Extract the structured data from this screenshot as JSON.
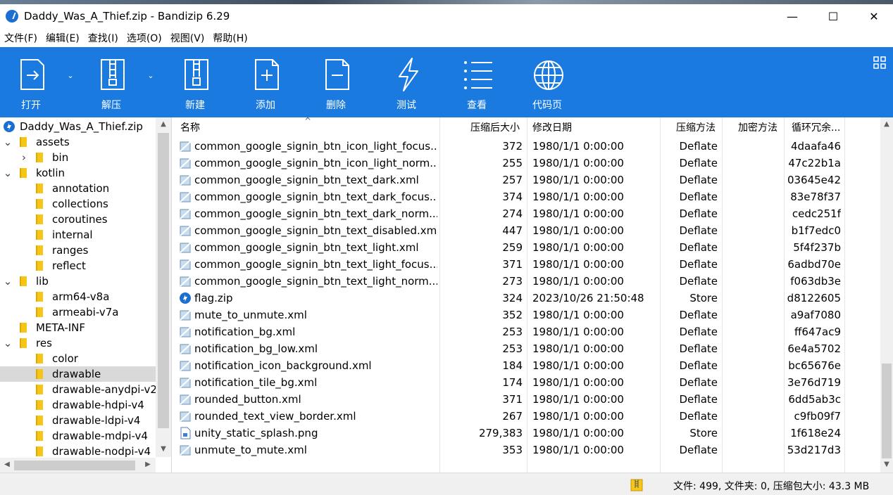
{
  "window": {
    "title": "Daddy_Was_A_Thief.zip - Bandizip 6.29",
    "minimize": "—",
    "maximize": "☐",
    "close": "✕"
  },
  "menu": [
    "文件(F)",
    "编辑(E)",
    "查找(I)",
    "选项(O)",
    "视图(V)",
    "帮助(H)"
  ],
  "toolbar": {
    "open": "打开",
    "extract": "解压",
    "new": "新建",
    "add": "添加",
    "delete": "删除",
    "test": "测试",
    "view": "查看",
    "codepage": "代码页"
  },
  "tree": {
    "root": "Daddy_Was_A_Thief.zip",
    "items": [
      {
        "label": "assets",
        "twist": "v"
      },
      {
        "label": "bin",
        "twist": ">"
      },
      {
        "label": "kotlin",
        "twist": "v"
      },
      {
        "label": "annotation",
        "twist": ""
      },
      {
        "label": "collections",
        "twist": ""
      },
      {
        "label": "coroutines",
        "twist": ""
      },
      {
        "label": "internal",
        "twist": ""
      },
      {
        "label": "ranges",
        "twist": ""
      },
      {
        "label": "reflect",
        "twist": ""
      },
      {
        "label": "lib",
        "twist": "v"
      },
      {
        "label": "arm64-v8a",
        "twist": ""
      },
      {
        "label": "armeabi-v7a",
        "twist": ""
      },
      {
        "label": "META-INF",
        "twist": ""
      },
      {
        "label": "res",
        "twist": "v"
      },
      {
        "label": "color",
        "twist": ""
      },
      {
        "label": "drawable",
        "twist": "",
        "selected": true
      },
      {
        "label": "drawable-anydpi-v2",
        "twist": ""
      },
      {
        "label": "drawable-hdpi-v4",
        "twist": ""
      },
      {
        "label": "drawable-ldpi-v4",
        "twist": ""
      },
      {
        "label": "drawable-mdpi-v4",
        "twist": ""
      },
      {
        "label": "drawable-nodpi-v4",
        "twist": ""
      }
    ]
  },
  "columns": {
    "name": "名称",
    "size": "压缩后大小",
    "date": "修改日期",
    "method": "压缩方法",
    "encryption": "加密方法",
    "crc": "循环冗余..."
  },
  "files": [
    {
      "name": "common_google_signin_btn_icon_light_focus...",
      "size": "372",
      "date": "1980/1/1 0:00:00",
      "method": "Deflate",
      "crc": "4daafa46",
      "type": "xml"
    },
    {
      "name": "common_google_signin_btn_icon_light_norm...",
      "size": "255",
      "date": "1980/1/1 0:00:00",
      "method": "Deflate",
      "crc": "47c22b1a",
      "type": "xml"
    },
    {
      "name": "common_google_signin_btn_text_dark.xml",
      "size": "257",
      "date": "1980/1/1 0:00:00",
      "method": "Deflate",
      "crc": "03645e42",
      "type": "xml"
    },
    {
      "name": "common_google_signin_btn_text_dark_focus...",
      "size": "374",
      "date": "1980/1/1 0:00:00",
      "method": "Deflate",
      "crc": "83e78f37",
      "type": "xml"
    },
    {
      "name": "common_google_signin_btn_text_dark_norm...",
      "size": "274",
      "date": "1980/1/1 0:00:00",
      "method": "Deflate",
      "crc": "cedc251f",
      "type": "xml"
    },
    {
      "name": "common_google_signin_btn_text_disabled.xml",
      "size": "447",
      "date": "1980/1/1 0:00:00",
      "method": "Deflate",
      "crc": "b1f7edc0",
      "type": "xml"
    },
    {
      "name": "common_google_signin_btn_text_light.xml",
      "size": "259",
      "date": "1980/1/1 0:00:00",
      "method": "Deflate",
      "crc": "5f4f237b",
      "type": "xml"
    },
    {
      "name": "common_google_signin_btn_text_light_focus...",
      "size": "371",
      "date": "1980/1/1 0:00:00",
      "method": "Deflate",
      "crc": "6adbd70e",
      "type": "xml"
    },
    {
      "name": "common_google_signin_btn_text_light_norm...",
      "size": "273",
      "date": "1980/1/1 0:00:00",
      "method": "Deflate",
      "crc": "f063db3e",
      "type": "xml"
    },
    {
      "name": "flag.zip",
      "size": "324",
      "date": "2023/10/26 21:50:48",
      "method": "Store",
      "crc": "d8122605",
      "type": "zip"
    },
    {
      "name": "mute_to_unmute.xml",
      "size": "352",
      "date": "1980/1/1 0:00:00",
      "method": "Deflate",
      "crc": "a9af7080",
      "type": "xml"
    },
    {
      "name": "notification_bg.xml",
      "size": "253",
      "date": "1980/1/1 0:00:00",
      "method": "Deflate",
      "crc": "ff647ac9",
      "type": "xml"
    },
    {
      "name": "notification_bg_low.xml",
      "size": "253",
      "date": "1980/1/1 0:00:00",
      "method": "Deflate",
      "crc": "6e4a5702",
      "type": "xml"
    },
    {
      "name": "notification_icon_background.xml",
      "size": "184",
      "date": "1980/1/1 0:00:00",
      "method": "Deflate",
      "crc": "bc65676e",
      "type": "xml"
    },
    {
      "name": "notification_tile_bg.xml",
      "size": "174",
      "date": "1980/1/1 0:00:00",
      "method": "Deflate",
      "crc": "3e76d719",
      "type": "xml"
    },
    {
      "name": "rounded_button.xml",
      "size": "371",
      "date": "1980/1/1 0:00:00",
      "method": "Deflate",
      "crc": "6dd5ab3c",
      "type": "xml"
    },
    {
      "name": "rounded_text_view_border.xml",
      "size": "267",
      "date": "1980/1/1 0:00:00",
      "method": "Deflate",
      "crc": "c9fb09f7",
      "type": "xml"
    },
    {
      "name": "unity_static_splash.png",
      "size": "279,383",
      "date": "1980/1/1 0:00:00",
      "method": "Store",
      "crc": "1f618e24",
      "type": "png"
    },
    {
      "name": "unmute_to_mute.xml",
      "size": "353",
      "date": "1980/1/1 0:00:00",
      "method": "Deflate",
      "crc": "53d217d3",
      "type": "xml"
    }
  ],
  "status": "文件: 499, 文件夹: 0, 压缩包大小: 43.3 MB",
  "colors": {
    "toolbar": "#1a7ae0",
    "selection": "#d9d9d9",
    "folder": "#f5c518"
  }
}
